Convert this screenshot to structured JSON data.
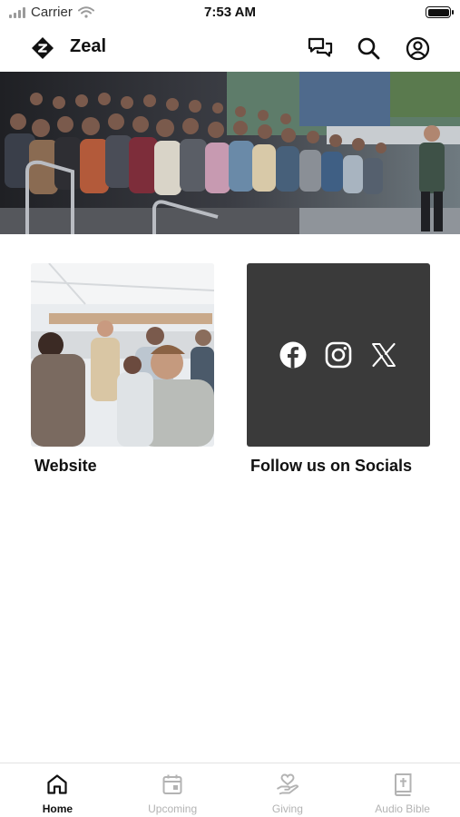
{
  "status_bar": {
    "carrier": "Carrier",
    "time": "7:53 AM"
  },
  "header": {
    "title": "Zeal",
    "icons": [
      "chat-icon",
      "search-icon",
      "profile-icon"
    ]
  },
  "hero": {
    "image": "conference-audience-photo"
  },
  "cards": {
    "website": {
      "label": "Website",
      "image": "event-attendees-photo"
    },
    "socials": {
      "label": "Follow us on Socials",
      "icons": [
        "facebook-icon",
        "instagram-icon",
        "x-icon"
      ],
      "background": "#3a3a3a"
    }
  },
  "tabbar": {
    "tabs": [
      {
        "label": "Home",
        "icon": "home-icon",
        "active": true
      },
      {
        "label": "Upcoming",
        "icon": "calendar-icon",
        "active": false
      },
      {
        "label": "Giving",
        "icon": "giving-hand-icon",
        "active": false
      },
      {
        "label": "Audio Bible",
        "icon": "bible-icon",
        "active": false
      }
    ]
  },
  "colors": {
    "accent": "#111111",
    "inactive": "#b3b3b3",
    "social_card": "#3a3a3a"
  }
}
